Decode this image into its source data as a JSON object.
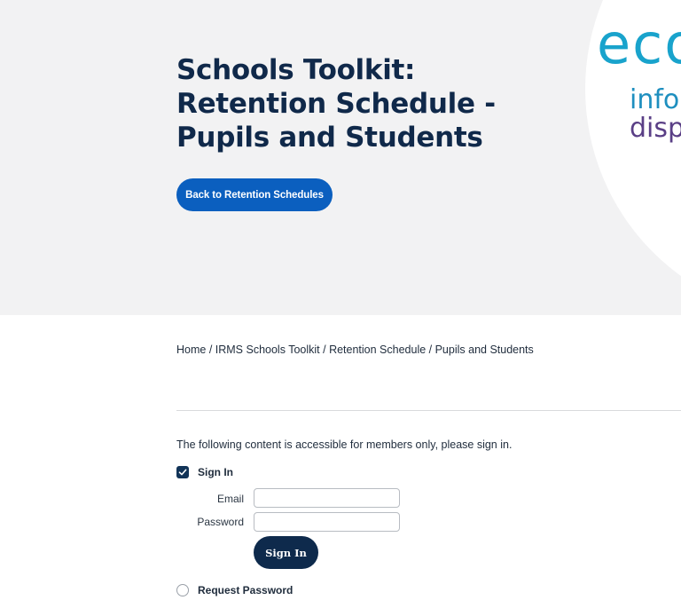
{
  "hero": {
    "title": "Schools Toolkit: Retention Schedule - Pupils and Students",
    "back_button_label": "Back to Retention Schedules",
    "background_color": "#f2f2f3",
    "button_color": "#0b5fbf"
  },
  "logo": {
    "big_text": "eco",
    "line1": "info",
    "line2": "disp",
    "colors": {
      "big": "#19a3cc",
      "line1": "#1e8fbf",
      "line2": "#5a3f86"
    }
  },
  "breadcrumb": {
    "items": [
      "Home",
      "IRMS Schools Toolkit",
      "Retention Schedule",
      "Pupils and Students"
    ],
    "separator": " / "
  },
  "notice": "The following content is accessible for members only, please sign in.",
  "signin_form": {
    "toggle_label": "Sign In",
    "toggle_checked": true,
    "email_label": "Email",
    "email_value": "",
    "password_label": "Password",
    "password_value": "",
    "submit_label": "Sign In",
    "button_color": "#0e2a4c"
  },
  "request_password": {
    "label": "Request Password",
    "checked": false
  }
}
